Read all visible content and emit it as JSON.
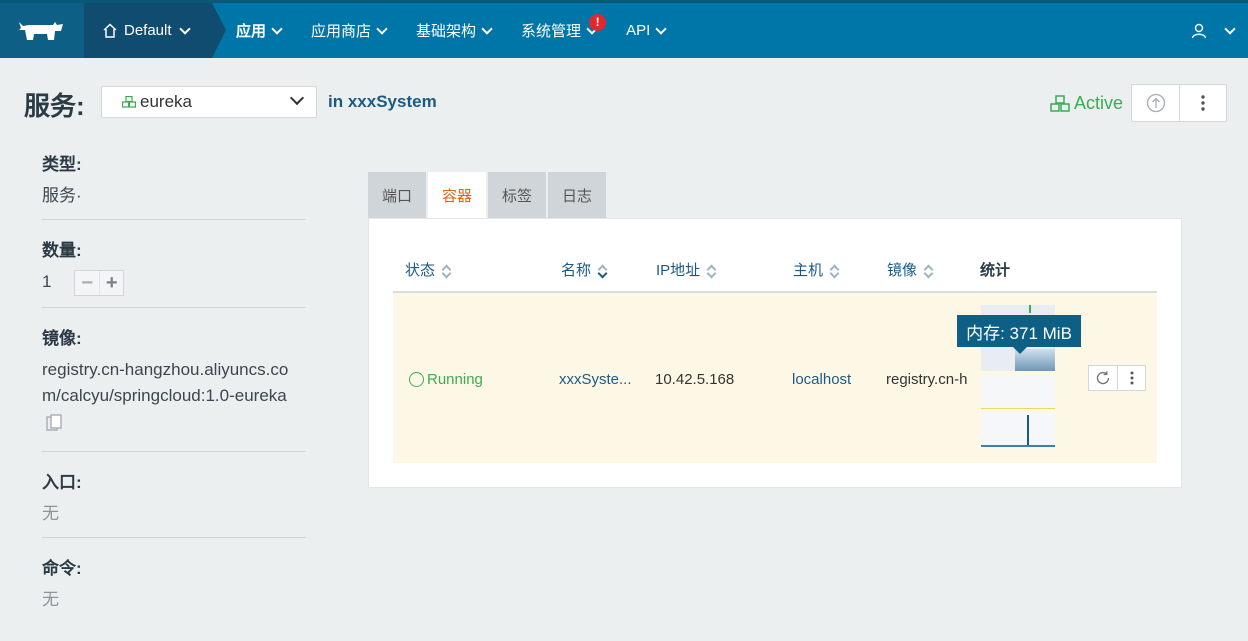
{
  "nav": {
    "environment": "Default",
    "items": [
      {
        "label": "应用",
        "active": true
      },
      {
        "label": "应用商店",
        "active": false
      },
      {
        "label": "基础架构",
        "active": false
      },
      {
        "label": "系统管理",
        "active": false,
        "alert": "!"
      },
      {
        "label": "API",
        "active": false
      }
    ]
  },
  "header": {
    "title": "服务:",
    "service_selected": "eureka",
    "in_prefix": "in",
    "stack_name": "xxxSystem",
    "status": "Active"
  },
  "info": {
    "type_label": "类型:",
    "type_value": "服务·",
    "scale_label": "数量:",
    "scale_value": "1",
    "image_label": "镜像:",
    "image_value": "registry.cn-hangzhou.aliyuncs.com/calcyu/springcloud:1.0-eureka",
    "ports_label": "入口:",
    "ports_value": "无",
    "command_label": "命令:",
    "command_value": "无"
  },
  "tabs": [
    "端口",
    "容器",
    "标签",
    "日志"
  ],
  "active_tab": "容器",
  "table": {
    "headers": [
      "状态",
      "名称",
      "IP地址",
      "主机",
      "镜像",
      "统计"
    ],
    "rows": [
      {
        "status": "Running",
        "name": "xxxSyste...",
        "ip": "10.42.5.168",
        "host": "localhost",
        "image": "registry.cn-h",
        "tooltip": "内存: 371 MiB"
      }
    ]
  },
  "colors": {
    "nav_bg": "#0075a8",
    "accent": "#1b5a85",
    "active_green": "#3aac52",
    "tab_active": "#e0641c",
    "row_highlight": "#fdf8e6"
  }
}
